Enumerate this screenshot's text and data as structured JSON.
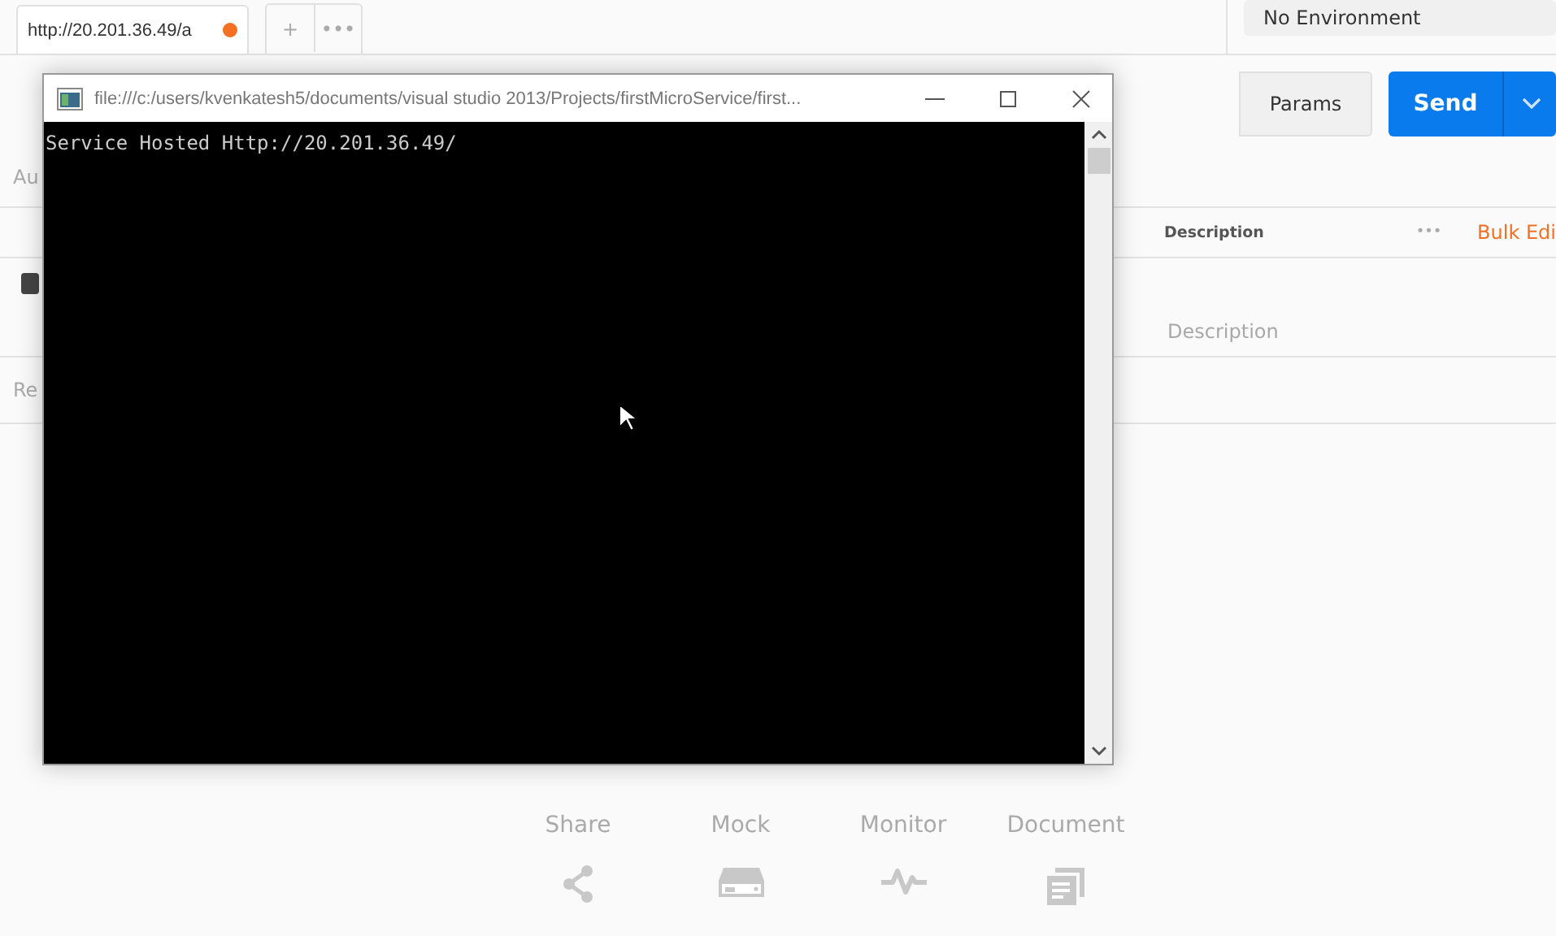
{
  "tabs": [
    {
      "label": "http://20.201.36.49/a",
      "unsaved": true,
      "selected": true
    }
  ],
  "tab_actions": [
    "+",
    "•••"
  ],
  "environment": {
    "value": "No Environment"
  },
  "request": {
    "params_button": "Params",
    "send_button": "Send"
  },
  "auth_tab_partial": "Au",
  "params_table": {
    "header": {
      "description": "Description",
      "more": "•••",
      "bulk_edit": "Bulk Edi"
    },
    "rows": [
      {
        "checked": true,
        "description_placeholder": "Description"
      }
    ]
  },
  "response_label_partial": "Re",
  "actions": [
    {
      "label": "Share",
      "kind": "share"
    },
    {
      "label": "Mock",
      "kind": "mock"
    },
    {
      "label": "Monitor",
      "kind": "monitor"
    },
    {
      "label": "Document",
      "kind": "document"
    }
  ],
  "console_window": {
    "title": "file:///c:/users/kvenkatesh5/documents/visual studio 2013/Projects/firstMicroService/first...",
    "output": "Service Hosted Http://20.201.36.49/"
  }
}
